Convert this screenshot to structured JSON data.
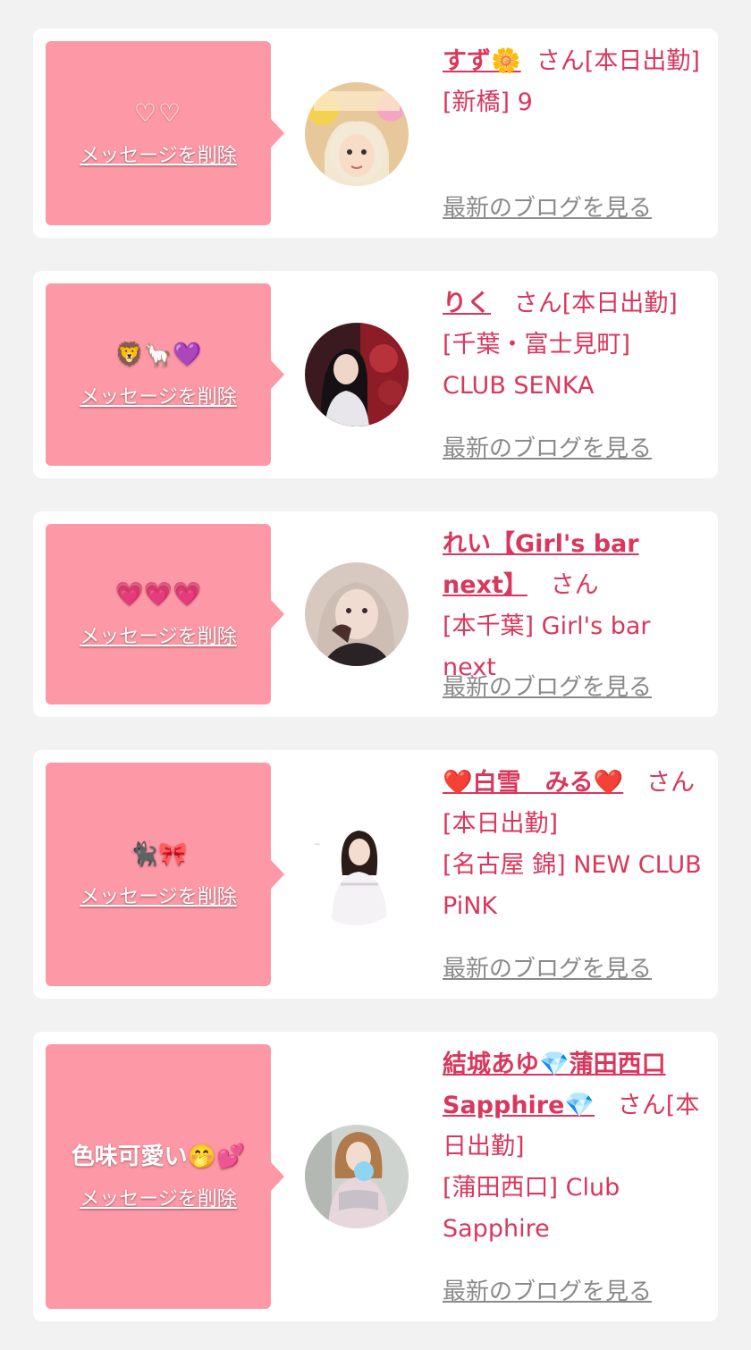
{
  "items": [
    {
      "message": "♡♡",
      "delete_label": "メッセージを削除",
      "name": "すず🌼",
      "san": "さん",
      "status": "[本日出勤]",
      "location": "[新橋] 9",
      "blog_label": "最新のブログを見る"
    },
    {
      "message": "🦁🦙💜",
      "delete_label": "メッセージを削除",
      "name": "りく",
      "san": "さん",
      "status": "[本日出勤]",
      "location": "[千葉・富士見町] CLUB SENKA",
      "blog_label": "最新のブログを見る"
    },
    {
      "message": "💗💗💗",
      "delete_label": "メッセージを削除",
      "name": "れい【Girl's bar next】",
      "san": "さん",
      "status": "",
      "location": "[本千葉] Girl's bar next",
      "blog_label": "最新のブログを見る"
    },
    {
      "message": "🐈‍⬛🎀",
      "delete_label": "メッセージを削除",
      "name": "❤️白雪　みる❤️",
      "san": "さん",
      "status": "[本日出勤]",
      "location": "[名古屋 錦] NEW CLUB PiNK",
      "blog_label": "最新のブログを見る"
    },
    {
      "message": "色味可愛い🤭💕",
      "delete_label": "メッセージを削除",
      "name": "結城あゆ💎蒲田西口Sapphire💎",
      "san": "さん",
      "status": "[本日出勤]",
      "location": "[蒲田西口] Club Sapphire",
      "blog_label": "最新のブログを見る"
    }
  ],
  "colors": {
    "bubble": "#fd98a6",
    "name": "#d9375d",
    "blog_link": "#8a8a8a",
    "page_bg": "#f2f2f2"
  }
}
